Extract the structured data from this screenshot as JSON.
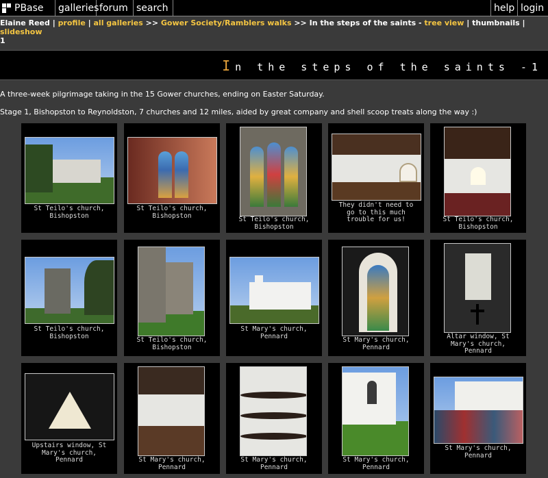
{
  "nav": {
    "logo": "PBase",
    "galleries": "galleries",
    "forum": "forum",
    "search": "search",
    "help": "help",
    "login": "login"
  },
  "breadcrumb": {
    "user": "Elaine Reed",
    "sep1": " | ",
    "profile": "profile",
    "sep2": " | ",
    "all_galleries": "all galleries",
    "arrow1": " >> ",
    "gower": "Gower Society/Ramblers walks",
    "arrow2": " >> ",
    "current": "In the steps of the saints - ",
    "tree_view": "tree view",
    "sep3": " | ",
    "thumbnails": "thumbnails",
    "sep4": " | ",
    "slideshow": "slideshow",
    "wrap": "1"
  },
  "title": {
    "first_letter": "I",
    "rest": "n the steps of the saints -1"
  },
  "description": {
    "line1": "A three-week pilgrimage taking in the 15 Gower churches, ending on Easter Saturday.",
    "line2": "Stage 1, Bishopston to Reynoldston, 7 churches and 12 miles, aided by great company and shell scoop treats along the way :)"
  },
  "thumbnails": [
    {
      "caption": [
        "St Teilo's church,",
        "Bishopston"
      ]
    },
    {
      "caption": [
        "St Teilo's church,",
        "Bishopston"
      ]
    },
    {
      "caption": [
        "St Teilo's church,",
        "Bishopston"
      ]
    },
    {
      "caption": [
        "They didn't need to",
        "go to this much",
        "trouble for us!"
      ]
    },
    {
      "caption": [
        "St Teilo's church,",
        "Bishopston"
      ]
    },
    {
      "caption": [
        "St Teilo's church,",
        "Bishopston"
      ]
    },
    {
      "caption": [
        "St Teilo's church,",
        "Bishopston"
      ]
    },
    {
      "caption": [
        "St Mary's church,",
        "Pennard"
      ]
    },
    {
      "caption": [
        "St Mary's church,",
        "Pennard"
      ]
    },
    {
      "caption": [
        "Altar window, St",
        "Mary's church,",
        "Pennard"
      ]
    },
    {
      "caption": [
        "Upstairs window, St",
        "Mary's church,",
        "Pennard"
      ]
    },
    {
      "caption": [
        "St Mary's church,",
        "Pennard"
      ]
    },
    {
      "caption": [
        "St Mary's church,",
        "Pennard"
      ]
    },
    {
      "caption": [
        "St Mary's church,",
        "Pennard"
      ]
    },
    {
      "caption": [
        "St Mary's church,",
        "Pennard"
      ]
    }
  ],
  "colors": {
    "background": "#3a3a3a",
    "link": "#f4c542",
    "title_accent": "#e8a33a"
  }
}
